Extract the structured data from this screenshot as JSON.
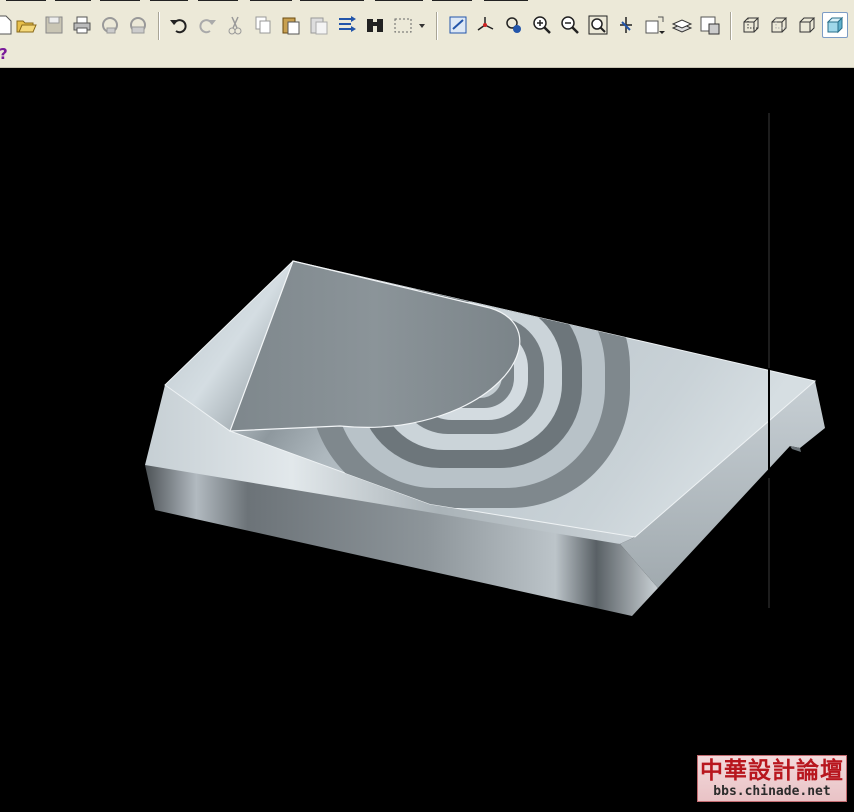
{
  "help_symbol": "?",
  "watermark": {
    "title": "中華設計論壇",
    "url": "bbs.chinade.net"
  },
  "toolbar": {
    "buttons": [
      {
        "name": "new-file",
        "icon": "new-file-icon"
      },
      {
        "name": "open-file",
        "icon": "folder-open-icon"
      },
      {
        "name": "save",
        "icon": "save-icon"
      },
      {
        "name": "print",
        "icon": "printer-icon"
      },
      {
        "name": "send",
        "icon": "send-icon"
      },
      {
        "name": "email",
        "icon": "email-icon"
      },
      {
        "name": "undo",
        "icon": "undo-icon"
      },
      {
        "name": "redo",
        "icon": "redo-icon"
      },
      {
        "name": "cut",
        "icon": "scissors-icon"
      },
      {
        "name": "copy",
        "icon": "copy-icon"
      },
      {
        "name": "paste",
        "icon": "paste-icon"
      },
      {
        "name": "paste-special",
        "icon": "paste-special-icon"
      },
      {
        "name": "regenerate",
        "icon": "regenerate-icon"
      },
      {
        "name": "find",
        "icon": "binoculars-icon"
      },
      {
        "name": "select-box",
        "icon": "selection-box-icon"
      },
      {
        "name": "repaint",
        "icon": "repaint-icon"
      },
      {
        "name": "spin-center",
        "icon": "spin-center-icon"
      },
      {
        "name": "orient",
        "icon": "orient-icon"
      },
      {
        "name": "zoom-in",
        "icon": "zoom-in-icon"
      },
      {
        "name": "zoom-out",
        "icon": "zoom-out-icon"
      },
      {
        "name": "refit",
        "icon": "refit-icon"
      },
      {
        "name": "reorient",
        "icon": "reorient-icon"
      },
      {
        "name": "named-views",
        "icon": "named-views-icon"
      },
      {
        "name": "layers",
        "icon": "layers-icon"
      },
      {
        "name": "view-manager",
        "icon": "view-manager-icon"
      },
      {
        "name": "wireframe",
        "icon": "wireframe-icon"
      },
      {
        "name": "hidden-line",
        "icon": "hidden-line-icon"
      },
      {
        "name": "no-hidden",
        "icon": "no-hidden-icon"
      },
      {
        "name": "shading",
        "icon": "shading-icon"
      }
    ]
  }
}
